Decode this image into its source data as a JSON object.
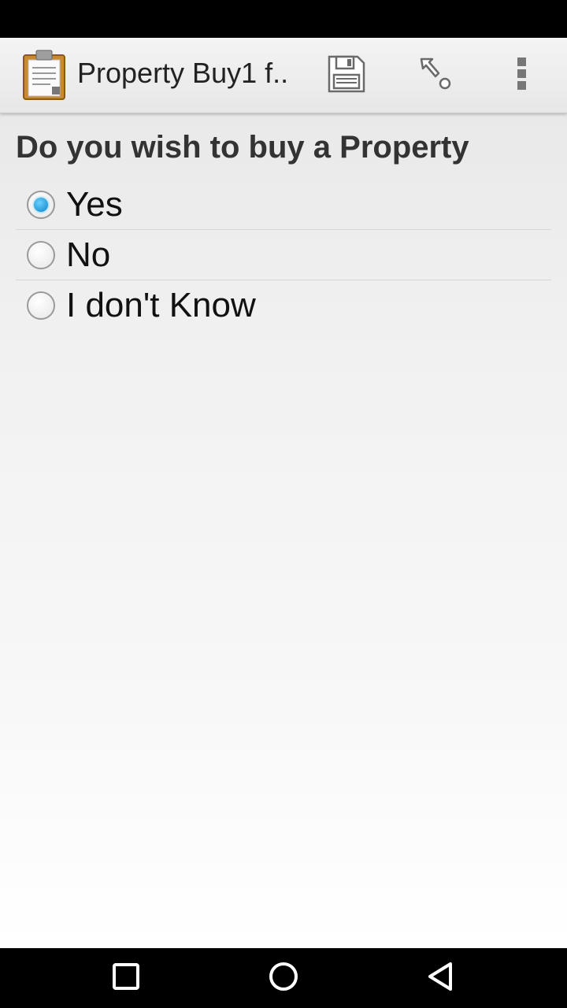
{
  "action_bar": {
    "app_icon": "clipboard-icon",
    "title": "Property Buy1 f..",
    "actions": [
      {
        "name": "save",
        "icon": "save-icon"
      },
      {
        "name": "go-to-prompt",
        "icon": "goto-icon"
      },
      {
        "name": "overflow-menu",
        "icon": "overflow-icon"
      }
    ]
  },
  "question": {
    "text": "Do you wish to buy a Property",
    "options": [
      {
        "label": "Yes",
        "selected": true
      },
      {
        "label": "No",
        "selected": false
      },
      {
        "label": "I don't Know",
        "selected": false
      }
    ]
  },
  "colors": {
    "accent": "#33b5e5",
    "radio_selected": "#0a84c8"
  },
  "nav_bar": {
    "buttons": [
      "recents-icon",
      "home-icon",
      "back-icon"
    ]
  }
}
